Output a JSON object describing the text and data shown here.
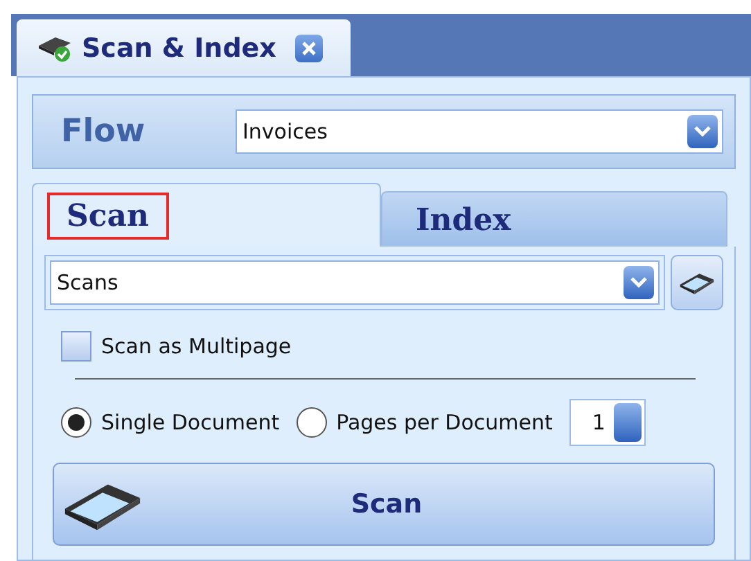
{
  "document_tab": {
    "title": "Scan & Index",
    "selected": true
  },
  "flow": {
    "label": "Flow",
    "value": "Invoices"
  },
  "tabs": [
    {
      "label": "Scan",
      "selected": true,
      "highlighted": true
    },
    {
      "label": "Index",
      "selected": false,
      "highlighted": false
    }
  ],
  "source": {
    "value": "Scans"
  },
  "multipage": {
    "label": "Scan as Multipage",
    "checked": false
  },
  "split_options": [
    {
      "label": "Single Document",
      "selected": true
    },
    {
      "label": "Pages per Document",
      "selected": false
    }
  ],
  "pages_per_document": {
    "value": "1"
  },
  "scan_button": {
    "label": "Scan"
  }
}
